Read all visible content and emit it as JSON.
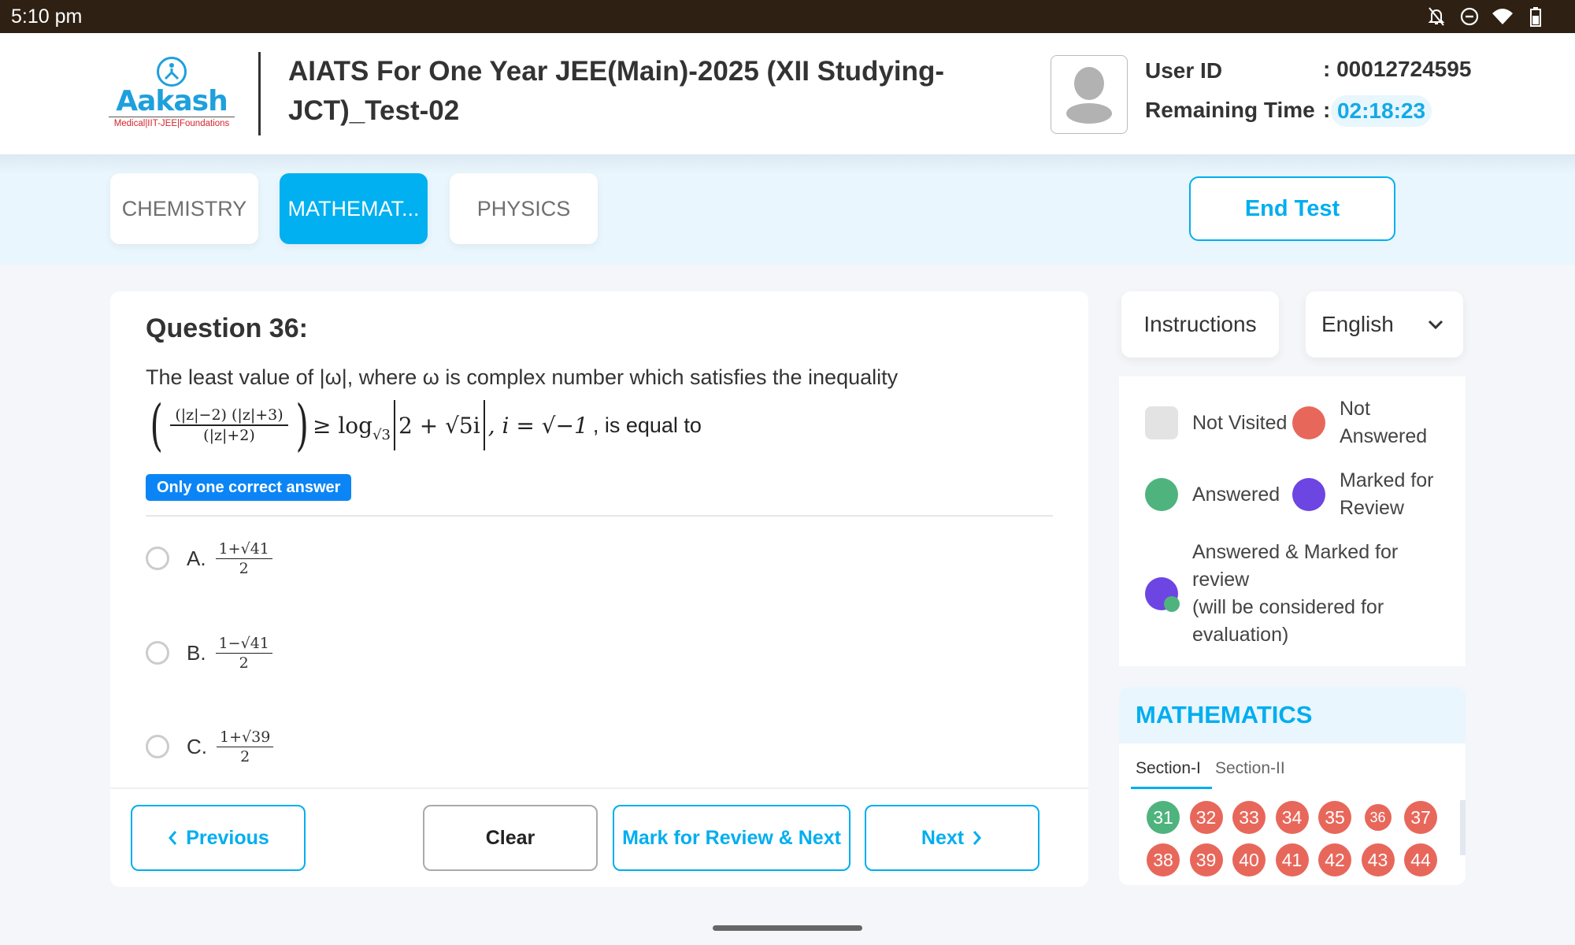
{
  "status_bar": {
    "time": "5:10 pm",
    "icons": [
      "notifications-off-icon",
      "do-not-disturb-icon",
      "wifi-icon",
      "battery-icon"
    ]
  },
  "header": {
    "logo": {
      "brand": "Aakash",
      "tagline": "Medical|IIT-JEE|Foundations"
    },
    "test_title": "AIATS For One Year JEE(Main)-2025 (XII Studying-JCT)_Test-02",
    "user_id_label": "User ID",
    "user_id_value": ": 00012724595",
    "remaining_time_label": "Remaining Time",
    "remaining_time_separator": ":",
    "remaining_time_value": "02:18:23"
  },
  "subjects": {
    "tabs": [
      {
        "label": "CHEMISTRY",
        "active": false
      },
      {
        "label": "MATHEMAT...",
        "active": true
      },
      {
        "label": "PHYSICS",
        "active": false
      }
    ],
    "end_test_label": "End Test"
  },
  "question": {
    "title": "Question 36:",
    "text": "The least value of |ω|, where ω is complex number which satisfies the inequality",
    "math": {
      "numerator": "(|z|−2) (|z|+3)",
      "denominator": "(|z|+2)",
      "relation": "≥ log",
      "log_base": "√3",
      "abs_content": "2 + √5i",
      "condition": ",  i = √−1",
      "tail": ", is equal to"
    },
    "answer_type": "Only one correct answer",
    "options": [
      {
        "letter": "A.",
        "numerator": "1+√41",
        "denominator": "2",
        "selected": false
      },
      {
        "letter": "B.",
        "numerator": "1−√41",
        "denominator": "2",
        "selected": false
      },
      {
        "letter": "C.",
        "numerator": "1+√39",
        "denominator": "2",
        "selected": false
      }
    ]
  },
  "footer": {
    "previous_label": "Previous",
    "clear_label": "Clear",
    "mark_review_label": "Mark for Review & Next",
    "next_label": "Next"
  },
  "sidebar": {
    "instructions_label": "Instructions",
    "language": "English",
    "legend": {
      "not_visited": "Not Visited",
      "not_answered": "Not Answered",
      "answered": "Answered",
      "marked_for_review": "Marked for Review",
      "answered_marked_line1": "Answered & Marked for review",
      "answered_marked_line2": "(will be considered for evaluation)"
    },
    "palette": {
      "subject": "MATHEMATICS",
      "sections": [
        "Section-I",
        "Section-II"
      ],
      "active_section": "Section-I",
      "questions": [
        {
          "number": "31",
          "status": "answered"
        },
        {
          "number": "32",
          "status": "not_answered"
        },
        {
          "number": "33",
          "status": "not_answered"
        },
        {
          "number": "34",
          "status": "not_answered"
        },
        {
          "number": "35",
          "status": "not_answered"
        },
        {
          "number": "36",
          "status": "not_answered",
          "current": true
        },
        {
          "number": "37",
          "status": "not_answered"
        },
        {
          "number": "38",
          "status": "not_answered"
        },
        {
          "number": "39",
          "status": "not_answered"
        },
        {
          "number": "40",
          "status": "not_answered"
        },
        {
          "number": "41",
          "status": "not_answered"
        },
        {
          "number": "42",
          "status": "not_answered"
        },
        {
          "number": "43",
          "status": "not_answered"
        },
        {
          "number": "44",
          "status": "not_answered"
        }
      ]
    }
  },
  "colors": {
    "accent": "#00aeef",
    "answered": "#4fb37e",
    "not_answered": "#e8675b",
    "marked": "#6c45e2",
    "not_visited": "#e3e3e3",
    "badge": "#0b85f5"
  }
}
